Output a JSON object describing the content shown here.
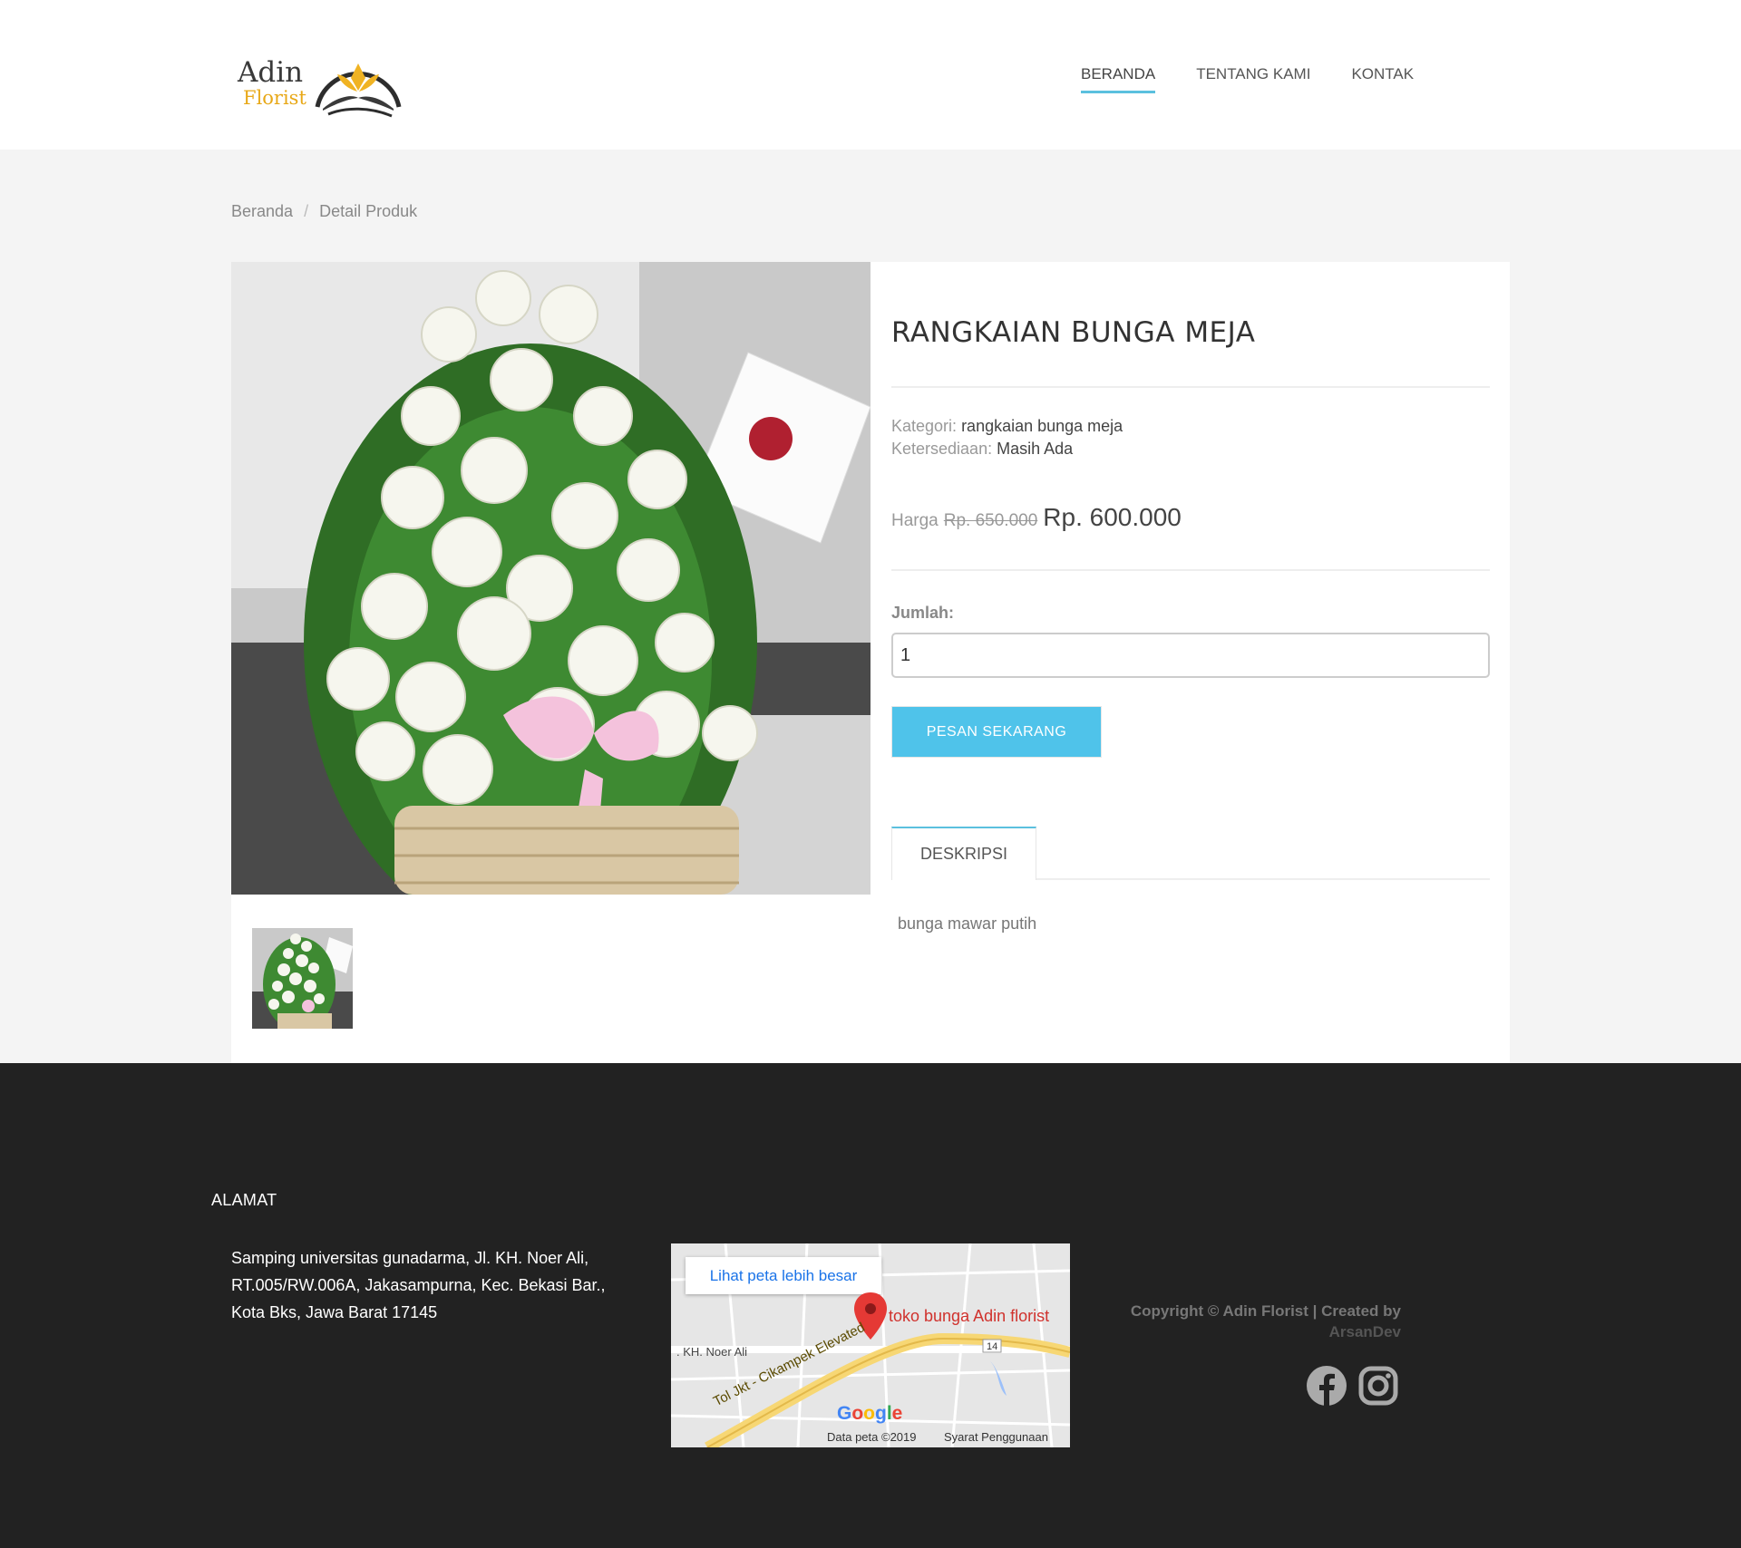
{
  "header": {
    "logo": {
      "line1": "Adin",
      "line2": "Florist"
    },
    "nav": [
      {
        "label": "BERANDA",
        "active": true
      },
      {
        "label": "TENTANG KAMI",
        "active": false
      },
      {
        "label": "KONTAK",
        "active": false
      }
    ]
  },
  "breadcrumb": {
    "home": "Beranda",
    "separator": "/",
    "current": "Detail Produk"
  },
  "product": {
    "title": "RANGKAIAN BUNGA MEJA",
    "category_label": "Kategori",
    "category_value": "rangkaian bunga meja",
    "availability_label": "Ketersediaan",
    "availability_value": "Masih Ada",
    "price_label": "Harga",
    "price_old": "Rp. 650.000",
    "price_new": "Rp. 600.000",
    "quantity_label": "Jumlah:",
    "quantity_value": "1",
    "order_button": "PESAN SEKARANG",
    "tab_label": "DESKRIPSI",
    "description": "bunga mawar putih"
  },
  "footer": {
    "heading": "ALAMAT",
    "address": "Samping universitas gunadarma, Jl. KH. Noer Ali, RT.005/RW.006A, Jakasampurna, Kec. Bekasi Bar., Kota Bks, Jawa Barat 17145",
    "map": {
      "link_label": "Lihat peta lebih besar",
      "place": "toko bunga Adin florist",
      "street": ". KH. Noer Ali",
      "road": "Tol Jkt - Cikampek Elevated",
      "route_number": "14",
      "google": "Google",
      "data": "Data peta ©2019",
      "terms": "Syarat Penggunaan"
    },
    "copyright": "Copyright © Adin Florist | Created by",
    "creator": "ArsanDev",
    "social": [
      "facebook-icon",
      "instagram-icon"
    ]
  },
  "colors": {
    "accent": "#4fc3ea",
    "footer_bg": "#222222",
    "page_bg": "#f4f4f4"
  }
}
